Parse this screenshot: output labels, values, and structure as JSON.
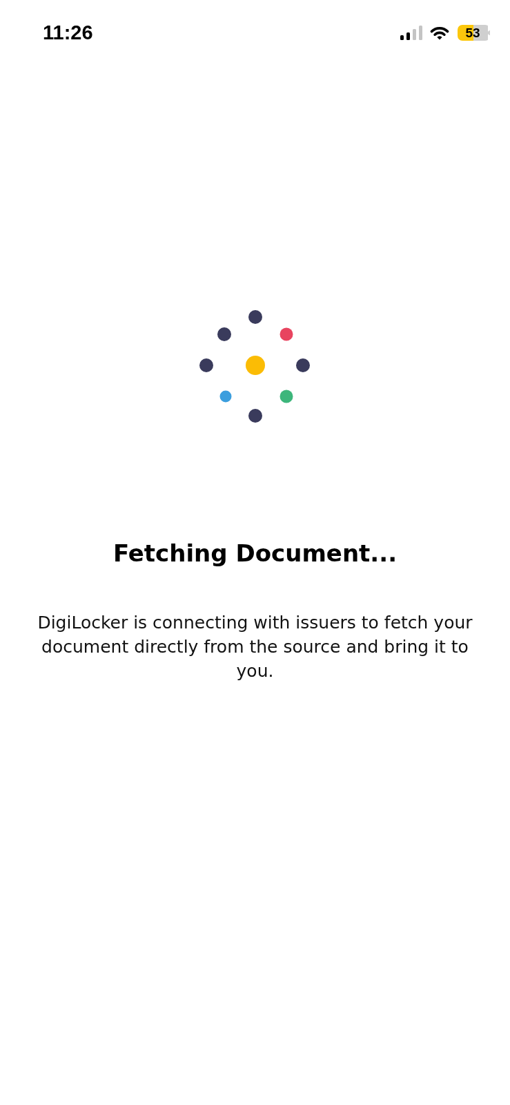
{
  "status_bar": {
    "time": "11:26",
    "battery": "53"
  },
  "loader": {
    "dots": [
      {
        "color": "#3a3b5c"
      },
      {
        "color": "#3a3b5c"
      },
      {
        "color": "#e8445f"
      },
      {
        "color": "#3a3b5c"
      },
      {
        "color": "#fbbc05"
      },
      {
        "color": "#3a3b5c"
      },
      {
        "color": "#3b9ede"
      },
      {
        "color": "#3db67b"
      },
      {
        "color": "#3a3b5c"
      }
    ]
  },
  "title": "Fetching Document...",
  "message": "DigiLocker is connecting with issuers to fetch your document directly from the source and bring it to you."
}
